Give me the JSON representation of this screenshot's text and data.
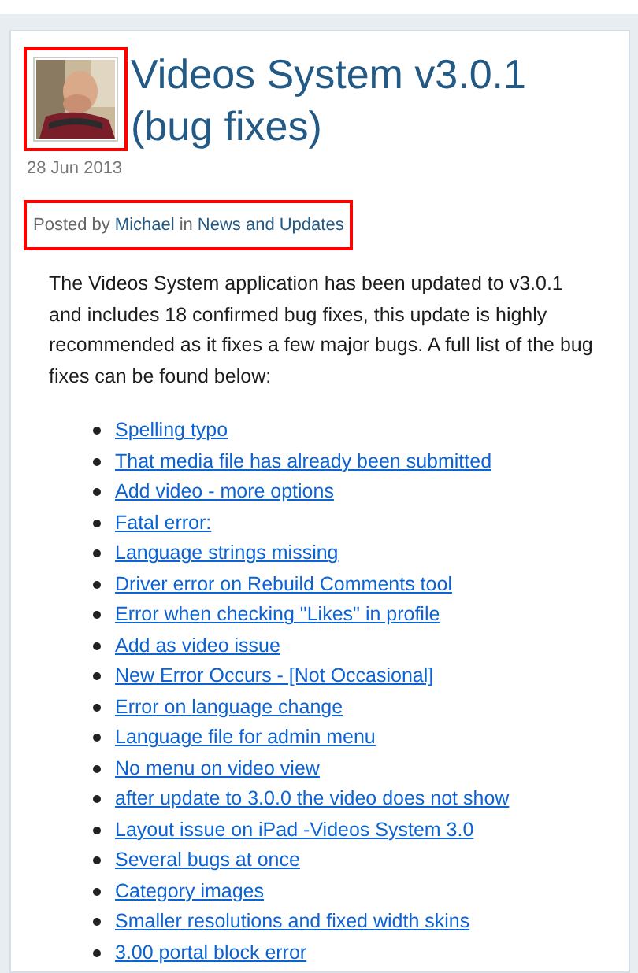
{
  "article": {
    "title": "Videos System v3.0.1 (bug fixes)",
    "date": "28 Jun 2013",
    "byline": {
      "prefix": "Posted by",
      "author": "Michael",
      "joiner": "in",
      "category": "News and Updates"
    },
    "body": "The Videos System application has been updated to v3.0.1 and includes 18 confirmed bug fixes, this update is highly recommended as it fixes a few major bugs. A full list of the bug fixes can be found below:",
    "fixes": [
      "Spelling typo",
      "That media file has already been submitted",
      "Add video - more options",
      "Fatal error:",
      "Language strings missing",
      "Driver error on Rebuild Comments tool",
      "Error when checking \"Likes\" in profile",
      "Add as video issue",
      "New Error Occurs - [Not Occasional]",
      "Error on language change",
      "Language file for admin menu",
      "No menu on video view",
      "after update to 3.0.0 the video does not show",
      "Layout issue on iPad -Videos System 3.0",
      "Several bugs at once",
      "Category images",
      "Smaller resolutions and fixed width skins",
      "3.00 portal block error"
    ]
  }
}
